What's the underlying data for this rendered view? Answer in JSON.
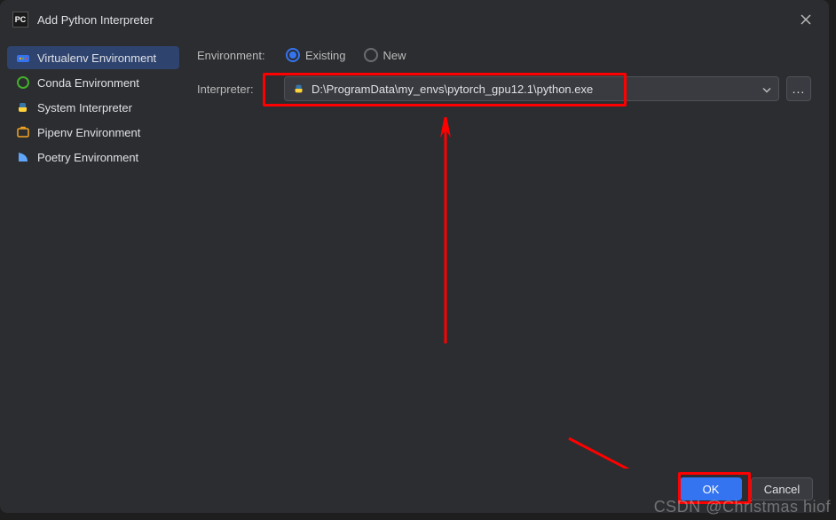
{
  "titlebar": {
    "app_icon_text": "PC",
    "title": "Add Python Interpreter"
  },
  "sidebar": {
    "items": [
      {
        "label": "Virtualenv Environment",
        "icon": "venv"
      },
      {
        "label": "Conda Environment",
        "icon": "conda"
      },
      {
        "label": "System Interpreter",
        "icon": "python"
      },
      {
        "label": "Pipenv Environment",
        "icon": "pipenv"
      },
      {
        "label": "Poetry Environment",
        "icon": "poetry"
      }
    ]
  },
  "main": {
    "environment_label": "Environment:",
    "radio_existing": "Existing",
    "radio_new": "New",
    "interpreter_label": "Interpreter:",
    "interpreter_path": "D:\\ProgramData\\my_envs\\pytorch_gpu12.1\\python.exe",
    "browse_text": "..."
  },
  "footer": {
    "ok": "OK",
    "cancel": "Cancel"
  },
  "watermark": "CSDN @Christmas hiof"
}
